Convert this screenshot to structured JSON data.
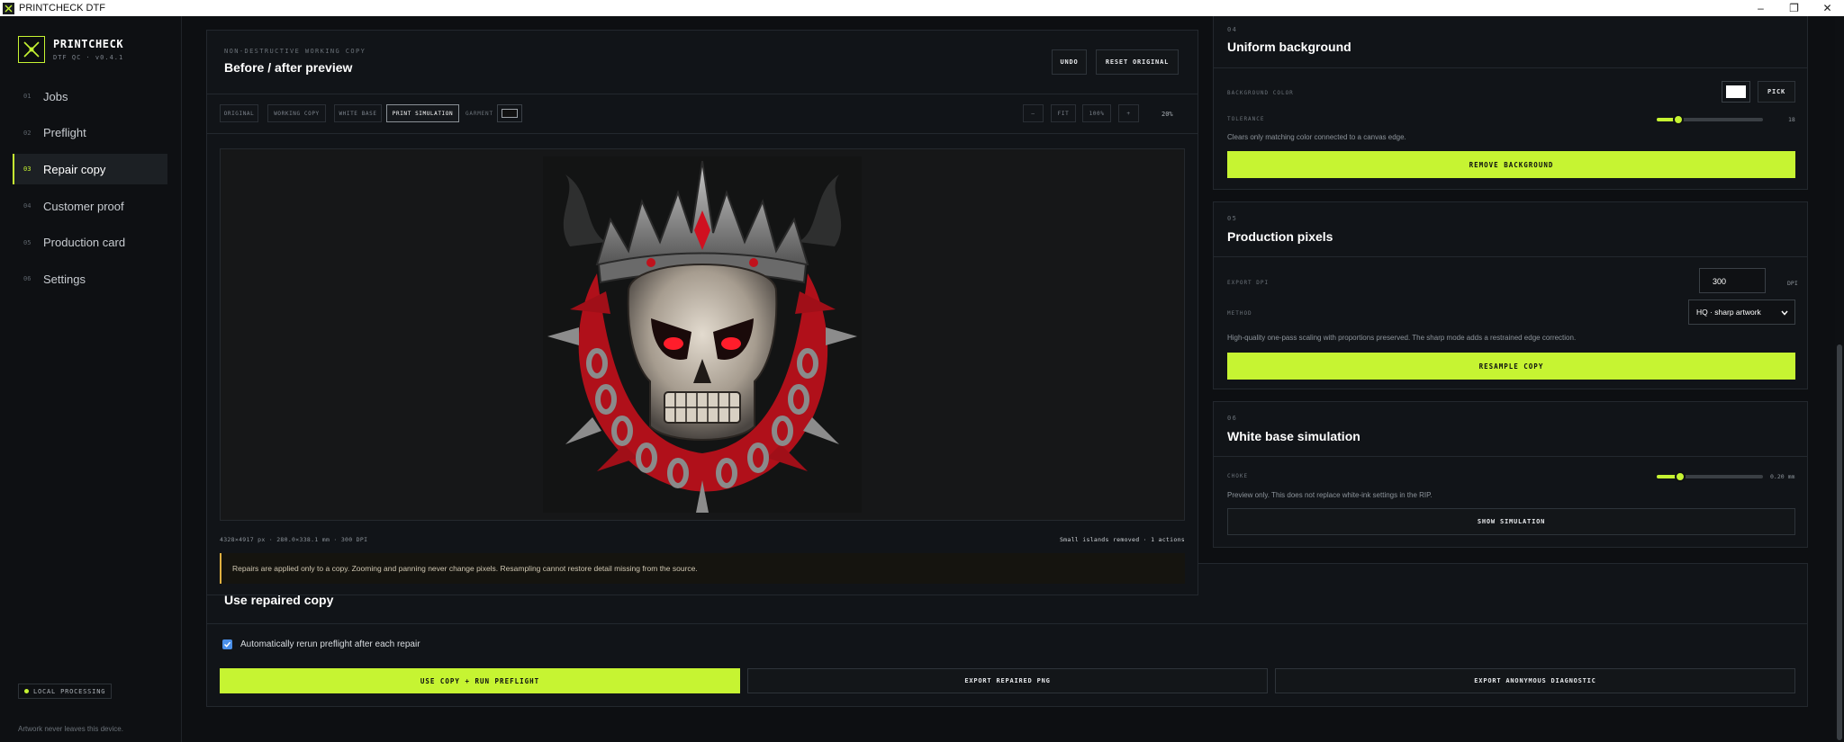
{
  "window": {
    "title": "PRINTCHECK DTF",
    "controls": [
      "–",
      "❐",
      "✕"
    ]
  },
  "sidebar": {
    "brand": {
      "name": "PRINTCHECK",
      "version": "DTF QC · v0.4.1"
    },
    "items": [
      {
        "num": "01",
        "label": "Jobs"
      },
      {
        "num": "02",
        "label": "Preflight"
      },
      {
        "num": "03",
        "label": "Repair copy"
      },
      {
        "num": "04",
        "label": "Customer proof"
      },
      {
        "num": "05",
        "label": "Production card"
      },
      {
        "num": "06",
        "label": "Settings"
      }
    ],
    "active_index": 2,
    "badge": "LOCAL PROCESSING",
    "note": "Artwork never leaves this device."
  },
  "preview": {
    "kicker": "NON-DESTRUCTIVE WORKING COPY",
    "title": "Before / after preview",
    "undo": "UNDO",
    "reset": "RESET ORIGINAL",
    "views": [
      "ORIGINAL",
      "WORKING COPY",
      "WHITE BASE",
      "PRINT SIMULATION"
    ],
    "active_view": "PRINT SIMULATION",
    "garment_label": "GARMENT",
    "garment_color": "#111111",
    "zoom_out": "–",
    "fit": "FIT",
    "zoom_100": "100%",
    "zoom_in": "+",
    "zoom_level": "20%",
    "file_info": "4328×4917 px · 280.0×338.1 mm · 300 DPI",
    "status": "Small islands removed · 1 actions",
    "notice": "Repairs are applied only to a copy. Zooming and panning never change pixels. Resampling cannot restore detail missing from the source."
  },
  "use_copy": {
    "title": "Use repaired copy",
    "auto_rerun_label": "Automatically rerun preflight after each repair",
    "auto_rerun_checked": true,
    "primary": "USE COPY + RUN PREFLIGHT",
    "export_png": "EXPORT REPAIRED PNG",
    "export_diag": "EXPORT ANONYMOUS DIAGNOSTIC"
  },
  "background": {
    "num": "04",
    "title": "Uniform background",
    "color_label": "BACKGROUND COLOR",
    "color_value": "#ffffff",
    "pick": "PICK",
    "tolerance_label": "TOLERANCE",
    "tolerance_value": "18",
    "tolerance_fraction": 0.2,
    "help": "Clears only matching color connected to a canvas edge.",
    "action": "REMOVE BACKGROUND"
  },
  "production": {
    "num": "05",
    "title": "Production pixels",
    "dpi_label": "EXPORT DPI",
    "dpi_value": "300",
    "dpi_unit": "DPI",
    "method_label": "METHOD",
    "method_value": "HQ · sharp artwork",
    "help": "High-quality one-pass scaling with proportions preserved. The sharp mode adds a restrained edge correction.",
    "action": "RESAMPLE COPY"
  },
  "whitebase": {
    "num": "06",
    "title": "White base simulation",
    "choke_label": "CHOKE",
    "choke_value": "0.20 mm",
    "choke_fraction": 0.22,
    "help": "Preview only. This does not replace white-ink settings in the RIP.",
    "action": "SHOW SIMULATION"
  },
  "colors": {
    "accent": "#c6f432",
    "blood": "#c0121c"
  }
}
